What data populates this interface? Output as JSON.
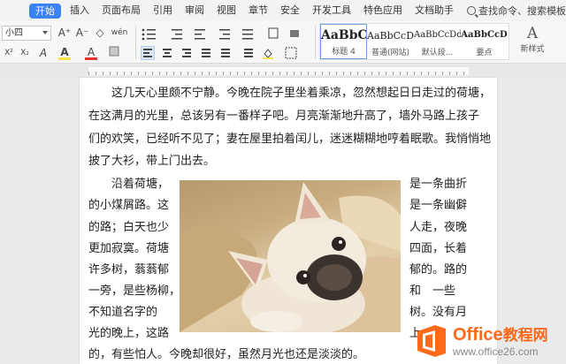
{
  "menubar": {
    "tabs": [
      "开始",
      "插入",
      "页面布局",
      "引用",
      "审阅",
      "视图",
      "章节",
      "安全",
      "开发工具",
      "特色应用",
      "文档助手"
    ],
    "active_tab": "开始",
    "search_label": "查找命令、搜索模板"
  },
  "toolbar": {
    "font_size": "小四",
    "row1_icons": [
      "A⁺",
      "A⁻",
      "◇",
      "wén"
    ],
    "row2_icons": [
      "X²",
      "X₂",
      "A",
      "A",
      "A"
    ],
    "styles": [
      {
        "sample": "AaBbC",
        "name": "标题 4"
      },
      {
        "sample": "AaBbCcD",
        "name": "普通(网站)"
      },
      {
        "sample": "AaBbCcDd",
        "name": "默认段..."
      },
      {
        "sample": "AaBbCcD",
        "name": "要点"
      }
    ],
    "new_style_label": "新样式"
  },
  "document": {
    "para1": [
      "这几天心里颇不宁静。今晚在院子里坐着乘凉，忽然想起日日走过的荷塘，",
      "在这满月的光里，总该另有一番样子吧。月亮渐渐地升高了，墙外马路上孩子",
      "们的欢笑，已经听不见了；妻在屋里拍着闰儿，迷迷糊糊地哼着眠歌。我悄悄地",
      "披了大衫，带上门出去。"
    ],
    "para2_left": [
      "沿着荷塘，",
      "的小煤屑路。这",
      "的路；白天也少",
      "更加寂寞。荷塘",
      "许多树，蓊蓊郁",
      "一旁，是些杨柳，",
      "不知道名字的",
      "光的晚上，这路"
    ],
    "para2_right": [
      "是一条曲折",
      "是一条幽僻",
      "人走，夜晚",
      "四面，长着",
      "郁的。路的",
      "和　一些",
      "树。没有月",
      "上"
    ],
    "last_line": "的，有些怕人。今晚却很好，虽然月光也还是淡淡的。"
  },
  "watermark": {
    "title_en": "Office",
    "title_zh": "教程网",
    "url": "www.office26.com"
  },
  "colors": {
    "accent": "#3b82f6",
    "brand_orange": "#ff6a1a"
  }
}
